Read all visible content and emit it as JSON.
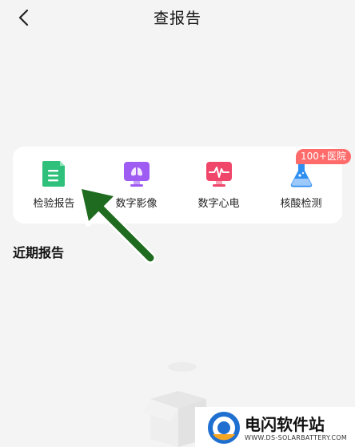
{
  "header": {
    "title": "查报告"
  },
  "services": [
    {
      "label": "检验报告",
      "icon": "document-report-icon",
      "color": "#2fc07b"
    },
    {
      "label": "数字影像",
      "icon": "monitor-lungs-icon",
      "color": "#9f5cf2"
    },
    {
      "label": "数字心电",
      "icon": "monitor-ecg-icon",
      "color": "#f0466a"
    },
    {
      "label": "核酸检测",
      "icon": "flask-icon",
      "color": "#2f8ff0"
    }
  ],
  "badge": {
    "text": "100+医院"
  },
  "recent": {
    "title": "近期报告"
  },
  "watermark": {
    "title": "电闪软件站",
    "url": "WWW.DS-SOLARBATTERY.COM"
  }
}
